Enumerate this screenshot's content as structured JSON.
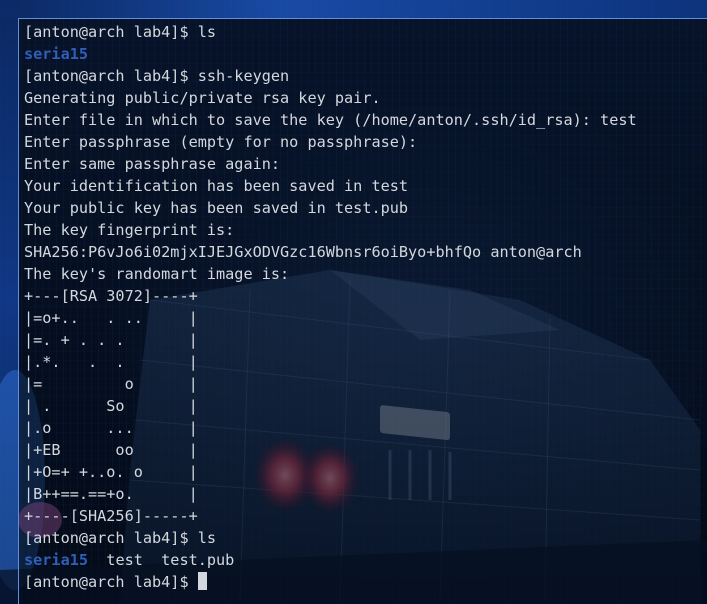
{
  "terminal": {
    "prompt1": "[anton@arch lab4]$ ls",
    "dir_output1": "seria15",
    "prompt2": "[anton@arch lab4]$ ssh-keygen",
    "output": [
      "Generating public/private rsa key pair.",
      "Enter file in which to save the key (/home/anton/.ssh/id_rsa): test",
      "Enter passphrase (empty for no passphrase):",
      "Enter same passphrase again:",
      "Your identification has been saved in test",
      "Your public key has been saved in test.pub",
      "The key fingerprint is:",
      "SHA256:P6vJo6i02mjxIJEJGxODVGzc16Wbnsr6oiByo+bhfQo anton@arch",
      "The key's randomart image is:"
    ],
    "randomart": [
      "+---[RSA 3072]----+",
      "|=o+..   . ..     |",
      "|=. + . . .       |",
      "|.*.   .  .       |",
      "|=         o      |",
      "| .      So       |",
      "|.o      ...      |",
      "|+EB      oo      |",
      "|+O=+ +..o. o     |",
      "|B++==.==+o.      |",
      "+----[SHA256]-----+"
    ],
    "prompt3": "[anton@arch lab4]$ ls",
    "ls2_dir": "seria15",
    "ls2_files": "  test  test.pub",
    "prompt4": "[anton@arch lab4]$ "
  },
  "colors": {
    "text": "#d4d8de",
    "directory": "#2f5fb8",
    "border": "#5f8de0"
  }
}
